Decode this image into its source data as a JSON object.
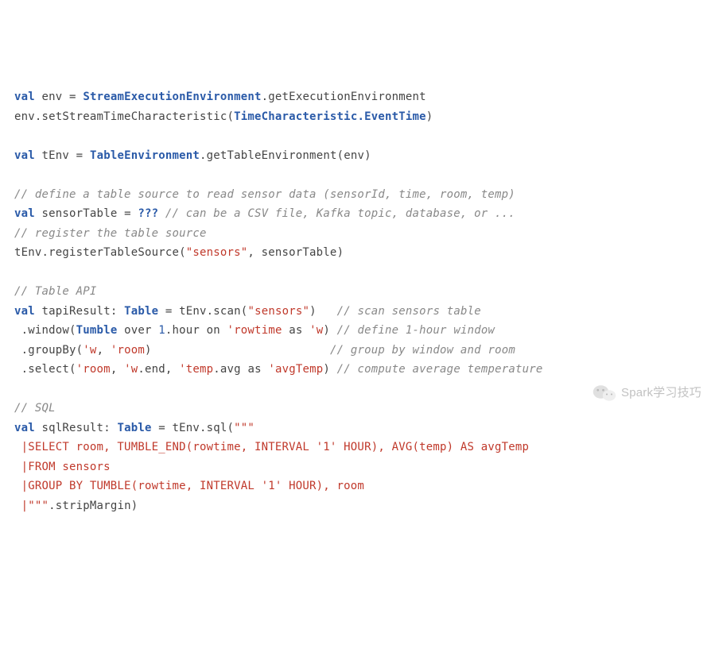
{
  "code": {
    "l1": {
      "kw_val": "val",
      "env_name": "env",
      "eq": " = ",
      "type": "StreamExecutionEnvironment",
      "dot_method": ".getExecutionEnvironment"
    },
    "l2": {
      "pre": "env.setStreamTimeCharacteristic(",
      "arg": "TimeCharacteristic.EventTime",
      "post": ")"
    },
    "l3": "",
    "l4": {
      "kw_val": "val",
      "var": "tEnv",
      "eq": " = ",
      "type": "TableEnvironment",
      "method": ".getTableEnvironment(env)"
    },
    "l5": "",
    "l6": {
      "comment": "// define a table source to read sensor data (sensorId, time, room, temp)"
    },
    "l7": {
      "kw_val": "val",
      "var": "sensorTable",
      "eq": " = ",
      "qmarks": "???",
      "comment": " // can be a CSV file, Kafka topic, database, or ..."
    },
    "l8": {
      "comment": "// register the table source"
    },
    "l9": {
      "pre": "tEnv.registerTableSource(",
      "str": "\"sensors\"",
      "post": ", sensorTable)"
    },
    "l10": "",
    "l11": {
      "comment": "// Table API"
    },
    "l12": {
      "kw_val": "val",
      "var": "tapiResult",
      "colon": ": ",
      "type": "Table",
      "eq": " = tEnv.scan(",
      "str": "\"sensors\"",
      "close": ")",
      "pad": "   ",
      "comment": "// scan sensors table"
    },
    "l13": {
      "p1": " .window(",
      "type": "Tumble",
      "p2": " over ",
      "num": "1",
      "p3": ".hour on ",
      "sym1": "'rowtime",
      "p4": " as ",
      "sym2": "'w",
      "p5": ") ",
      "comment": "// define 1-hour window"
    },
    "l14": {
      "p1": " .groupBy(",
      "sym1": "'w",
      "comma": ", ",
      "sym2": "'room",
      "p2": ")",
      "pad": "                          ",
      "comment": "// group by window and room"
    },
    "l15": {
      "p1": " .select(",
      "sym1": "'room",
      "c1": ", ",
      "sym2": "'w",
      "dot1": ".end, ",
      "sym3": "'temp",
      "dot2": ".avg as ",
      "sym4": "'avgTemp",
      "p2": ") ",
      "comment": "// compute average temperature"
    },
    "l16": "",
    "l17": {
      "comment": "// SQL"
    },
    "l18": {
      "kw_val": "val",
      "var": "sqlResult",
      "colon": ": ",
      "type": "Table",
      "eq": " = tEnv.sql(",
      "tq": "\"\"\""
    },
    "l19": {
      "sql": " |SELECT room, TUMBLE_END(rowtime, INTERVAL '1' HOUR), AVG(temp) AS avgTemp"
    },
    "l20": {
      "sql": " |FROM sensors"
    },
    "l21": {
      "sql": " |GROUP BY TUMBLE(rowtime, INTERVAL '1' HOUR), room"
    },
    "l22": {
      "sql_prefix": " |",
      "tq": "\"\"\"",
      "after": ".stripMargin)"
    }
  },
  "watermark": {
    "text": "Spark学习技巧"
  }
}
